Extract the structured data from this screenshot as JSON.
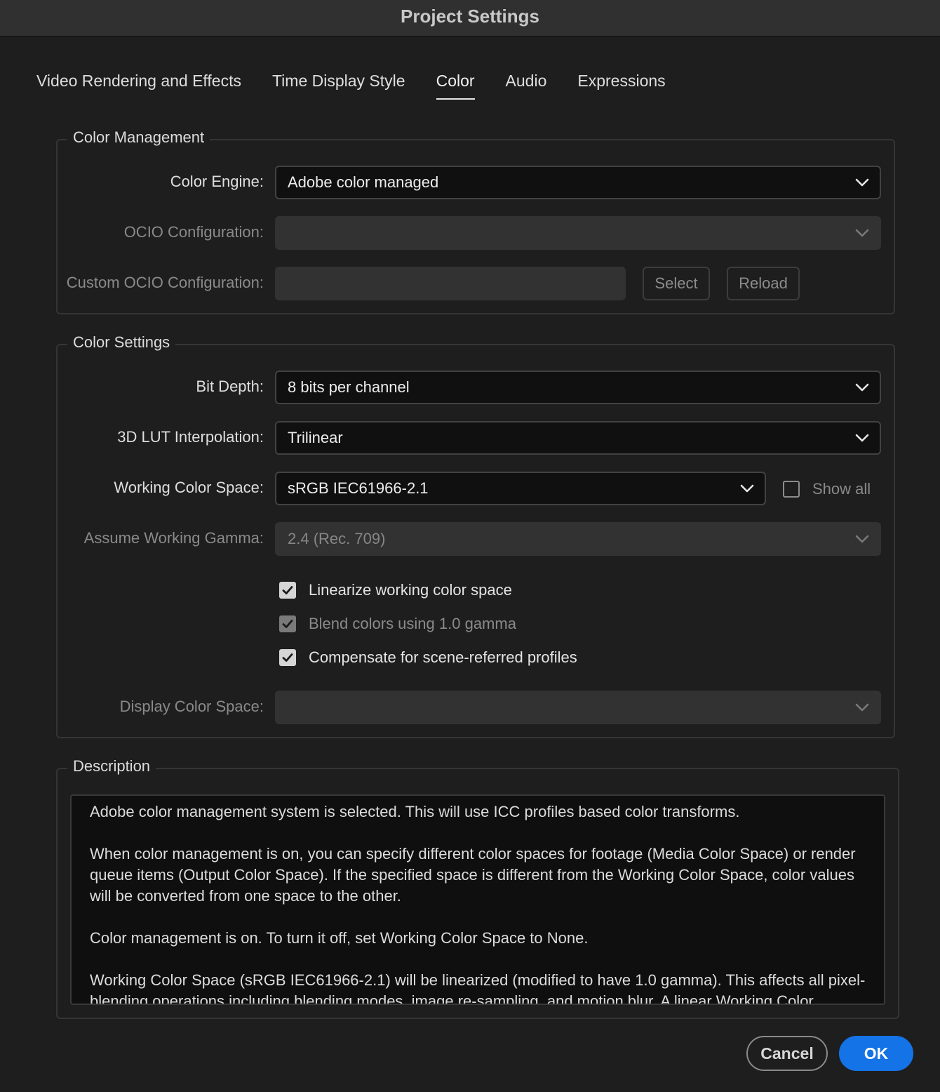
{
  "window": {
    "title": "Project Settings"
  },
  "tabs": [
    {
      "label": "Video Rendering and Effects",
      "active": false
    },
    {
      "label": "Time Display Style",
      "active": false
    },
    {
      "label": "Color",
      "active": true
    },
    {
      "label": "Audio",
      "active": false
    },
    {
      "label": "Expressions",
      "active": false
    }
  ],
  "color_management": {
    "legend": "Color Management",
    "color_engine": {
      "label": "Color Engine:",
      "value": "Adobe color managed"
    },
    "ocio_configuration": {
      "label": "OCIO Configuration:",
      "value": ""
    },
    "custom_ocio": {
      "label": "Custom OCIO Configuration:",
      "value": "",
      "select_label": "Select",
      "reload_label": "Reload"
    }
  },
  "color_settings": {
    "legend": "Color Settings",
    "bit_depth": {
      "label": "Bit Depth:",
      "value": "8 bits per channel"
    },
    "lut_interpolation": {
      "label": "3D LUT Interpolation:",
      "value": "Trilinear"
    },
    "working_color_space": {
      "label": "Working Color Space:",
      "value": "sRGB IEC61966-2.1",
      "show_all_label": "Show all",
      "show_all_checked": false
    },
    "assume_working_gamma": {
      "label": "Assume Working Gamma:",
      "value": "2.4 (Rec. 709)"
    },
    "checkboxes": [
      {
        "label": "Linearize working color space",
        "checked": true,
        "enabled": true
      },
      {
        "label": "Blend colors using 1.0 gamma",
        "checked": true,
        "enabled": false
      },
      {
        "label": "Compensate for scene-referred profiles",
        "checked": true,
        "enabled": true
      }
    ],
    "display_color_space": {
      "label": "Display Color Space:",
      "value": ""
    }
  },
  "description": {
    "legend": "Description",
    "text": "Adobe color management system is selected. This will use ICC profiles based color transforms.\n\nWhen color management is on, you can specify different color spaces for footage (Media Color Space) or render queue items (Output Color Space). If the specified space is different from the Working Color Space, color values will be converted from one space to the other.\n\nColor management is on. To turn it off, set Working Color Space to None.\n\nWorking Color Space (sRGB IEC61966-2.1) will be linearized (modified to have 1.0 gamma). This affects all pixel-blending operations including blending modes, image re-sampling, and motion blur. A linear Working Color"
  },
  "footer": {
    "cancel_label": "Cancel",
    "ok_label": "OK"
  },
  "colors": {
    "accent": "#1473e6",
    "background": "#1e1e1e",
    "field": "#101010",
    "disabled_field": "#323232"
  }
}
